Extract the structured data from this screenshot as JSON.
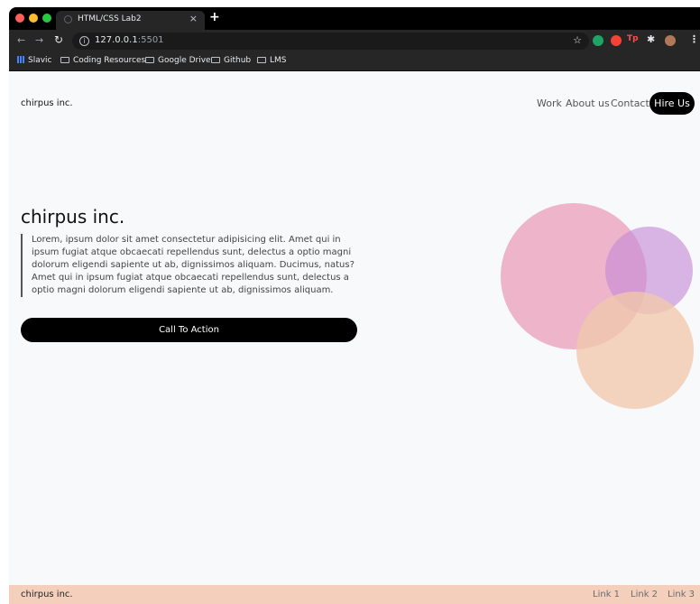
{
  "browser": {
    "tab_title": "HTML/CSS Lab2",
    "tab_close": "×",
    "new_tab": "+",
    "url_host": "127.0.0.1",
    "url_port": ":5501",
    "bookmarks": [
      "Slavic",
      "Coding Resources",
      "Google Drive",
      "Github",
      "LMS"
    ],
    "extension_tp": "Tp"
  },
  "header": {
    "brand": "chirpus inc.",
    "nav": [
      "Work",
      "About us",
      "Contact"
    ],
    "hire_button": "Hire Us"
  },
  "hero": {
    "title": "chirpus inc.",
    "text": "Lorem, ipsum dolor sit amet consectetur adipisicing elit. Amet qui in ipsum fugiat atque obcaecati repellendus sunt, delectus a optio magni dolorum eligendi sapiente ut ab, dignissimos aliquam. Ducimus, natus? Amet qui in ipsum fugiat atque obcaecati repellendus sunt, delectus a optio magni dolorum eligendi sapiente ut ab, dignissimos aliquam.",
    "cta": "Call To Action"
  },
  "footer": {
    "brand": "chirpus inc.",
    "links": [
      "Link 1",
      "Link 2",
      "Link 3"
    ]
  },
  "colors": {
    "circle_pink": "#eaa2bc",
    "circle_purple": "#c589d6",
    "circle_peach": "#f1c8ac",
    "footer_bg": "#f4cfbc",
    "button_bg": "#000000"
  }
}
